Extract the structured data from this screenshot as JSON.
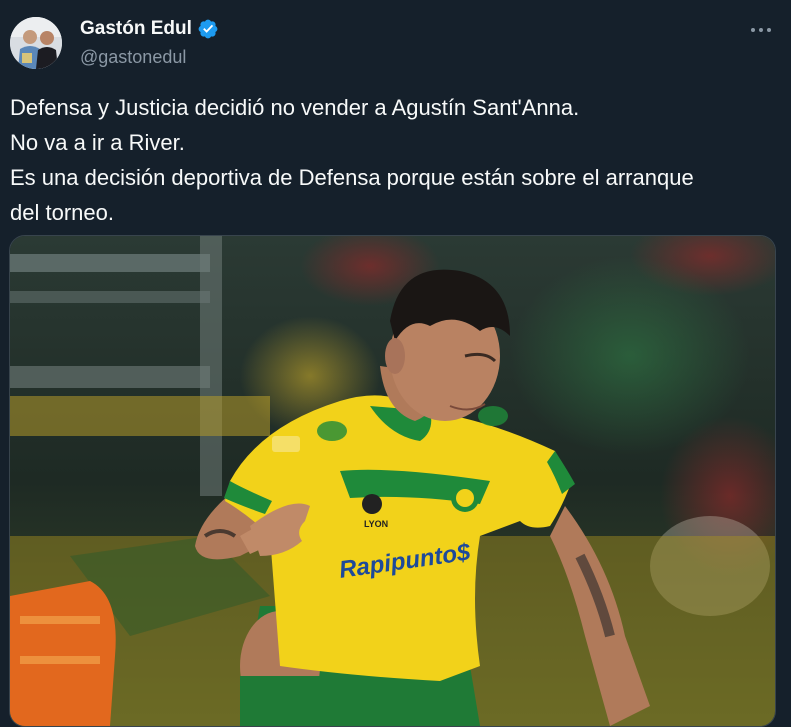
{
  "author": {
    "display_name": "Gastón Edul",
    "handle": "@gastonedul"
  },
  "tweet": {
    "lines": [
      "Defensa y Justicia decidió no vender a Agustín Sant'Anna.",
      "No va a ir a River.",
      "Es una decisión deportiva de Defensa porque están sobre el arranque",
      "del torneo."
    ]
  },
  "media": {
    "sponsor_text": "Rapipunto$",
    "kit_maker_text": "LYON",
    "icon": "soccer-player-photo"
  },
  "colors": {
    "background": "#15202b",
    "text": "#f7f9f9",
    "secondary_text": "#8b98a5",
    "verified_blue": "#1d9bf0",
    "jersey_yellow": "#f2d21a",
    "jersey_green": "#1f8a3a"
  }
}
